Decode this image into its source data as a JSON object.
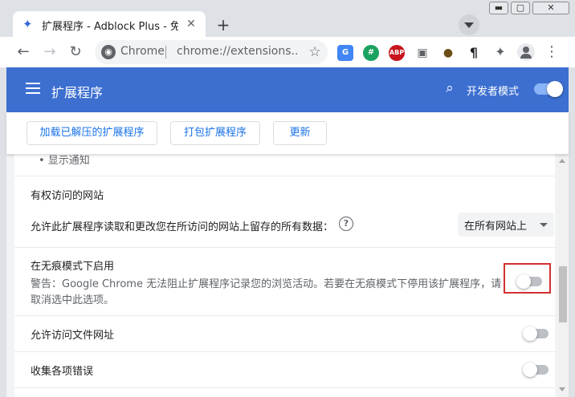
{
  "tab": {
    "title": "扩展程序 - Adblock Plus - 免费的",
    "close_glyph": "✕",
    "new_tab_glyph": "+"
  },
  "window": {
    "min_glyph": "▬",
    "max_glyph": "▢",
    "close_glyph": "✕"
  },
  "toolbar": {
    "back_glyph": "←",
    "forward_glyph": "→",
    "reload_glyph": "↻",
    "omnibox_site_label": "Chrome",
    "omnibox_url": "chrome://extensions...",
    "star_glyph": "☆",
    "extensions": [
      {
        "name": "google-translate-icon",
        "label": "G",
        "color": "#4285f4"
      },
      {
        "name": "pin-extension-icon",
        "label": "#",
        "color": "#1aa260"
      },
      {
        "name": "adblock-plus-icon",
        "label": "ABP",
        "color": "#c7161d"
      },
      {
        "name": "game-controller-icon",
        "label": "▣",
        "color": "#5f6368"
      },
      {
        "name": "tampermonkey-icon",
        "label": "●",
        "color": "#6b4e16"
      },
      {
        "name": "pilcrow-icon",
        "label": "¶",
        "color": "#202124"
      }
    ],
    "puzzle_glyph": "✦",
    "menu_glyph": "⋮"
  },
  "header": {
    "title": "扩展程序",
    "dev_mode_label": "开发者模式",
    "search_glyph": "⌕"
  },
  "actions": {
    "load_unpacked": "加载已解压的扩展程序",
    "pack": "打包扩展程序",
    "update": "更新"
  },
  "details": {
    "partial_item": "•  显示通知",
    "site_access": {
      "title": "有权访问的网站",
      "description": "允许此扩展程序读取和更改您在所访问的网站上留存的所有数据：",
      "help_glyph": "?",
      "selected": "在所有网站上"
    },
    "incognito": {
      "title": "在无痕模式下启用",
      "warning_line1": "警告：Google Chrome 无法阻止扩展程序记录您的浏览活动。若要在无痕模式下停用该扩展程序，请",
      "warning_line2": "取消选中此选项。",
      "enabled": false
    },
    "file_urls": {
      "title": "允许访问文件网址",
      "enabled": false
    },
    "collect_errors": {
      "title": "收集各项错误",
      "enabled": false
    }
  },
  "colors": {
    "header_bg": "#3c6fd0",
    "accent": "#1a73e8",
    "highlight": "#d32f2f"
  }
}
